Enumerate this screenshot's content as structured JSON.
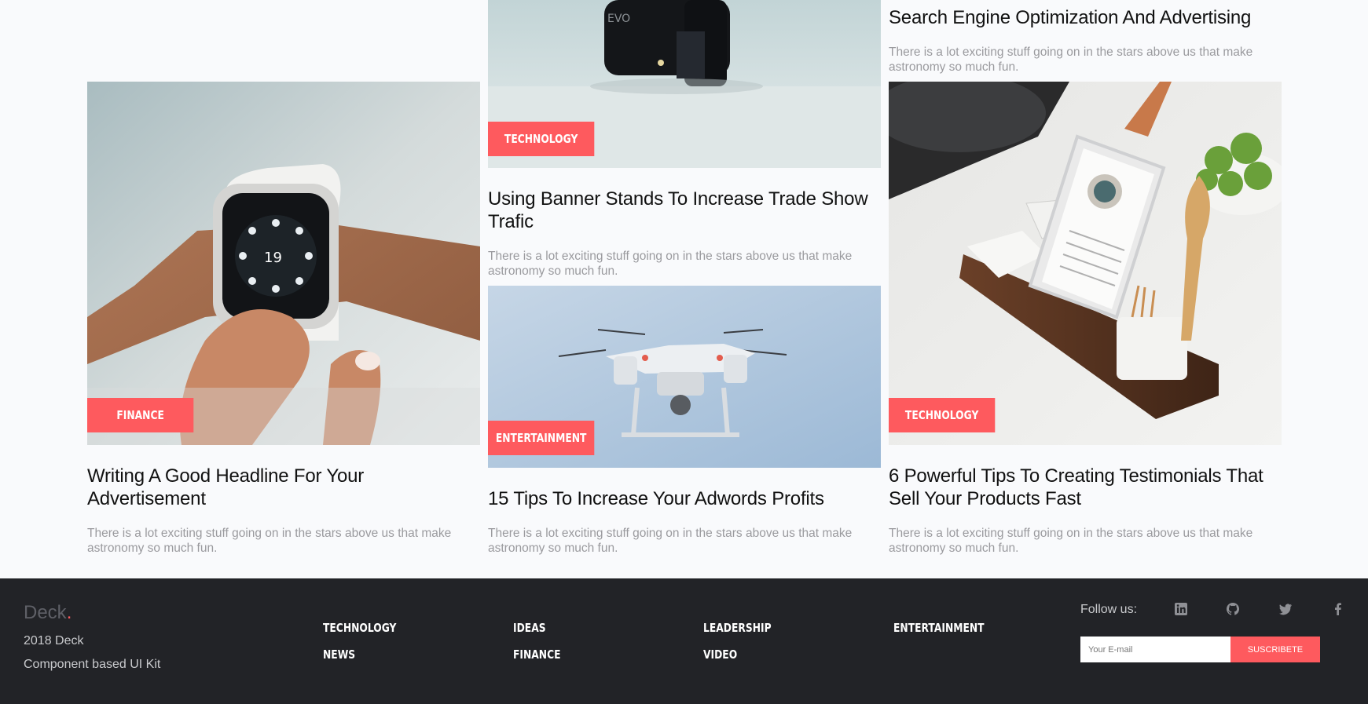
{
  "cards": [
    {
      "title": "Writing A Good Headline For Your Advertisement",
      "description": "There is a lot exciting stuff going on in the stars above us that make astronomy so much fun.",
      "tag": "FINANCE",
      "image": "smartwatch-photo"
    },
    {
      "tag": "TECHNOLOGY",
      "image": "camera-photo"
    },
    {
      "title": "Using Banner Stands To Increase Trade Show Trafic",
      "description": "There is a lot exciting stuff going on in the stars above us that make astronomy so much fun.",
      "tag": "ENTERTAINMENT",
      "image": "drone-photo"
    },
    {
      "title": "15 Tips To Increase Your Adwords Profits",
      "description": "There is a lot exciting stuff going on in the stars above us that make astronomy so much fun."
    },
    {
      "title": "Search Engine Optimization And Advertising",
      "description": "There is a lot exciting stuff going on in the stars above us that make astronomy so much fun."
    },
    {
      "title": "6 Powerful Tips To Creating Testimonials That Sell Your Products Fast",
      "description": "There is a lot exciting stuff going on in the stars above us that make astronomy so much fun.",
      "tag": "TECHNOLOGY",
      "image": "tablet-kitchen-photo"
    }
  ],
  "footer": {
    "brand": "Deck",
    "brand_dot": ".",
    "year_line": "2018 Deck",
    "tagline": "Component based UI Kit",
    "nav": [
      "TECHNOLOGY",
      "NEWS",
      "IDEAS",
      "FINANCE",
      "LEADERSHIP",
      "VIDEO",
      "ENTERTAINMENT"
    ],
    "follow_label": "Follow us:",
    "social": [
      "linkedin-icon",
      "github-icon",
      "twitter-icon",
      "facebook-icon"
    ],
    "email_placeholder": "Your E-mail",
    "subscribe_label": "SUSCRIBETE"
  },
  "colors": {
    "accent": "#fe5a5e",
    "footer_bg": "#222327",
    "page_bg": "#f9fafc"
  }
}
